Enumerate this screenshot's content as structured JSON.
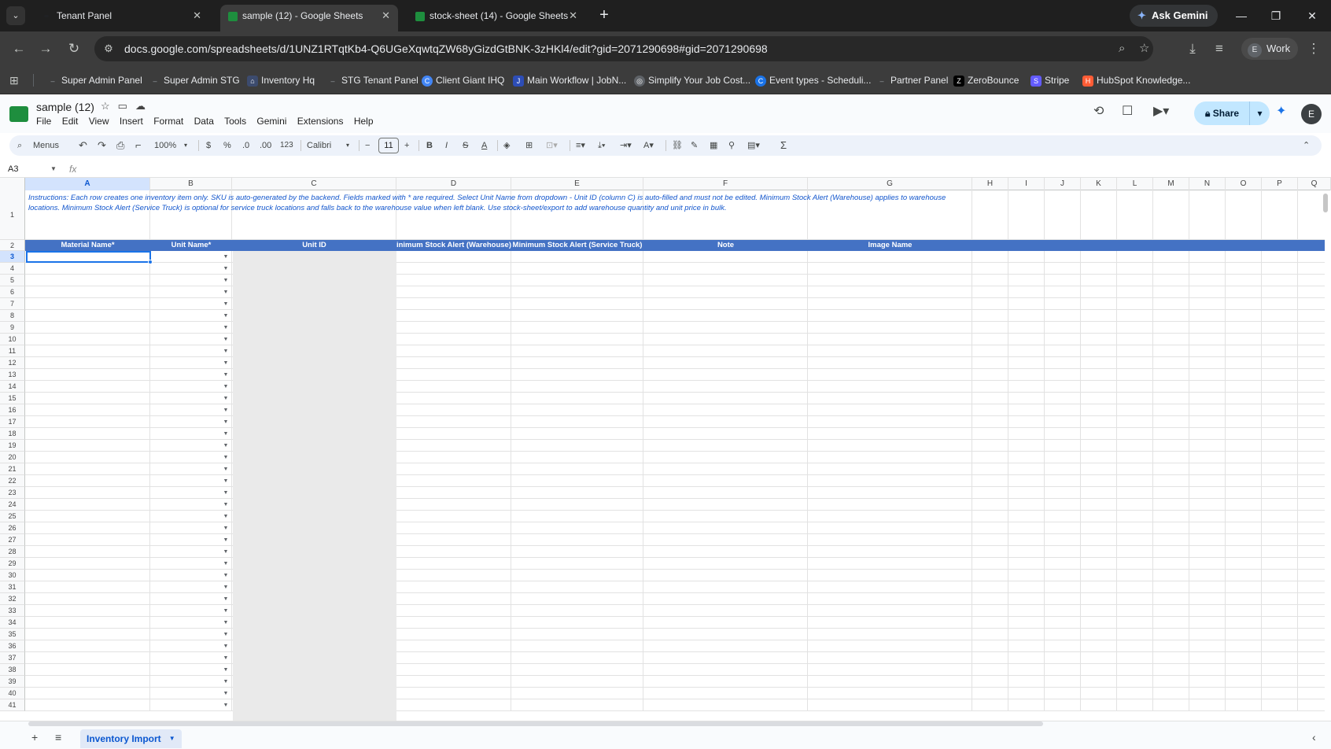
{
  "browser": {
    "tabs": [
      {
        "title": "Tenant Panel",
        "active": false
      },
      {
        "title": "sample (12) - Google Sheets",
        "active": true
      },
      {
        "title": "stock-sheet (14) - Google Sheets",
        "active": false
      }
    ],
    "ask_gemini": "Ask Gemini",
    "url": "docs.google.com/spreadsheets/d/1UNZ1RTqtKb4-Q6UGeXqwtqZW68yGizdGtBNK-3zHKl4/edit?gid=2071290698#gid=2071290698",
    "profile": {
      "initial": "E",
      "label": "Work"
    },
    "bookmarks": [
      "Super Admin Panel",
      "Super Admin STG",
      "Inventory Hq",
      "STG Tenant Panel",
      "Client Giant IHQ",
      "Main Workflow | JobN...",
      "Simplify Your Job Cost...",
      "Event types - Scheduli...",
      "Partner Panel",
      "ZeroBounce",
      "Stripe",
      "HubSpot Knowledge..."
    ]
  },
  "sheets": {
    "title": "sample (12)",
    "menus": [
      "File",
      "Edit",
      "View",
      "Insert",
      "Format",
      "Data",
      "Tools",
      "Gemini",
      "Extensions",
      "Help"
    ],
    "share_label": "Share",
    "avatar_initial": "E",
    "toolbar": {
      "search_label": "Menus",
      "zoom": "100%",
      "currency": "$",
      "percent": "%",
      "dec_decrease": ".0",
      "dec_increase": ".00",
      "number_format": "123",
      "font": "Calibri",
      "font_size": "11",
      "bold": "B",
      "italic": "I",
      "strike": "S",
      "text_color": "A",
      "sum": "Σ"
    },
    "name_box": "A3",
    "fx": "fx",
    "columns": [
      "A",
      "B",
      "C",
      "D",
      "E",
      "F",
      "G",
      "H",
      "I",
      "J",
      "K",
      "L",
      "M",
      "N",
      "O",
      "P",
      "Q"
    ],
    "row_numbers": [
      "1",
      "2",
      "3",
      "4",
      "5",
      "6",
      "7",
      "8",
      "9",
      "10",
      "11",
      "12",
      "13",
      "14",
      "15",
      "16",
      "17",
      "18",
      "19",
      "20",
      "21",
      "22",
      "23",
      "24",
      "25",
      "26",
      "27",
      "28",
      "29",
      "30",
      "31",
      "32",
      "33",
      "34",
      "35",
      "36",
      "37",
      "38",
      "39",
      "40",
      "41"
    ],
    "instructions": "Instructions: Each row creates one inventory item only. SKU is auto-generated by the backend. Fields marked with * are required. Select Unit Name from dropdown - Unit ID (column C) is auto-filled and must not be edited. Minimum Stock Alert (Warehouse) applies to warehouse locations. Minimum Stock Alert (Service Truck) is optional for service truck locations and falls back to the warehouse value when left blank. Use stock-sheet/export to add warehouse quantity and unit price in bulk.",
    "headers": [
      "Material Name*",
      "Unit Name*",
      "Unit ID",
      "Minimum Stock Alert (Warehouse)",
      "Minimum Stock Alert (Service Truck)",
      "Note",
      "Image Name"
    ],
    "header_color": "#4472c4",
    "instruction_color": "#1155cc",
    "sheet_tab": "Inventory Import"
  }
}
